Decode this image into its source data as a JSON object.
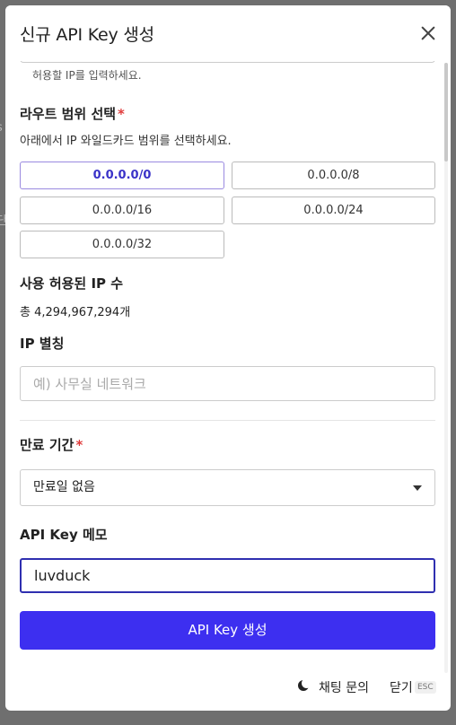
{
  "background": {
    "glyph_1": "s",
    "glyph_2": "단"
  },
  "modal": {
    "title": "신규 API Key 생성",
    "ip_help": "허용할 IP를 입력하세요.",
    "route_label": "라우트 범위 선택",
    "required_mark": "*",
    "route_desc": "아래에서 IP 와일드카드 범위를 선택하세요.",
    "ranges": [
      "0.0.0.0/0",
      "0.0.0.0/8",
      "0.0.0.0/16",
      "0.0.0.0/24",
      "0.0.0.0/32"
    ],
    "selected_range": "0.0.0.0/0",
    "allowed_count_label": "사용 허용된 IP 수",
    "allowed_count_value": "총 4,294,967,294개",
    "alias_label": "IP 별칭",
    "alias_placeholder": "예) 사무실 네트워크",
    "expire_label": "만료 기간",
    "expire_value": "만료일 없음",
    "memo_label": "API Key 메모",
    "memo_value": "luvduck",
    "submit_label": "API Key 생성",
    "chat_label": "채팅 문의",
    "close_label": "닫기",
    "esc_badge": "ESC"
  },
  "colors": {
    "accent": "#3d2ff0",
    "required": "#e03b3b",
    "active_border": "#9a8ae0"
  }
}
